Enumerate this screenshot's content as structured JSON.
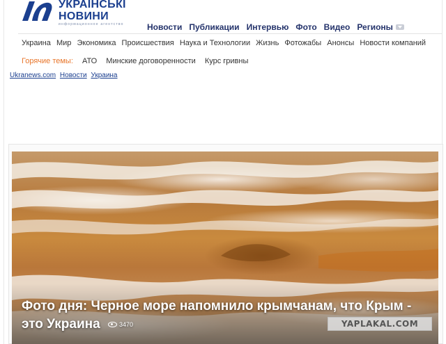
{
  "logo": {
    "line1": "УКРАЇНСЬКІ",
    "line2": "НОВИНИ",
    "subtitle": "информационное агентство"
  },
  "topnav": [
    "Новости",
    "Публикации",
    "Интервью",
    "Фото",
    "Видео",
    "Регионы"
  ],
  "secnav": [
    "Украина",
    "Мир",
    "Экономика",
    "Происшествия",
    "Наука и Технологии",
    "Жизнь",
    "Фотожабы",
    "Анонсы",
    "Новости компаний"
  ],
  "hot": {
    "label": "Горячие темы:",
    "items": [
      "АТО",
      "Минские договоренности",
      "Курс гривны"
    ]
  },
  "breadcrumb": [
    "Ukranews.com",
    "Новости",
    "Украина"
  ],
  "hero": {
    "title": "Фото дня: Черное море напомнило крымчанам, что Крым - это Украина",
    "views": "3470"
  },
  "watermark": "YAPLAKAL.COM",
  "colors": {
    "brand": "#1b3f8f",
    "nav": "#24336b",
    "hot": "#e8762b"
  }
}
